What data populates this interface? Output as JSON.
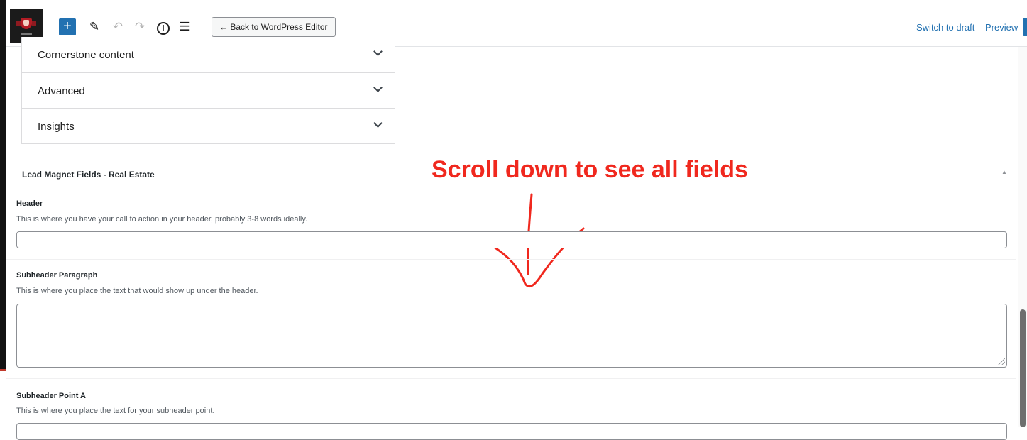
{
  "toolbar": {
    "add_icon": "+",
    "pen_icon": "✎",
    "undo_icon": "↶",
    "redo_icon": "↷",
    "info_icon": "i",
    "list_icon": "☰",
    "back_button": "← Back to WordPress Editor",
    "switch_to_draft": "Switch to draft",
    "preview": "Preview"
  },
  "accordion": {
    "items": [
      {
        "label": "Cornerstone content"
      },
      {
        "label": "Advanced"
      },
      {
        "label": "Insights"
      }
    ]
  },
  "metabox": {
    "title": "Lead Magnet Fields - Real Estate",
    "toggle_icon": "▲"
  },
  "annotation": {
    "text": "Scroll down to see all fields",
    "color": "#f0281e"
  },
  "fields": [
    {
      "label": "Header",
      "description": "This is where you have your call to action in your header, probably 3-8 words ideally.",
      "value": ""
    },
    {
      "label": "Subheader Paragraph",
      "description": "This is where you place the text that would show up under the header.",
      "value": ""
    },
    {
      "label": "Subheader Point A",
      "description": "This is where you place the text for your subheader point.",
      "value": ""
    }
  ],
  "colors": {
    "accent": "#2271b1",
    "annotation_red": "#f0281e"
  }
}
